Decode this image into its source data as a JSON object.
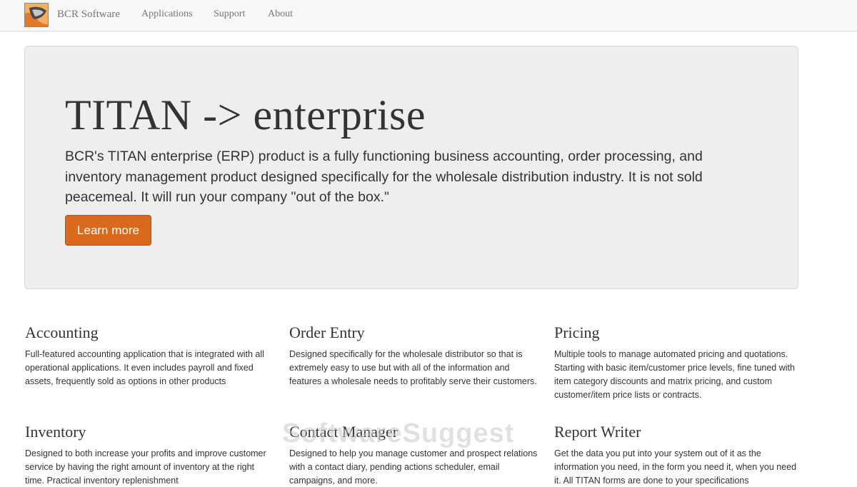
{
  "navbar": {
    "brand": "BCR Software",
    "links": [
      "Applications",
      "Support",
      "About"
    ]
  },
  "hero": {
    "title": "TITAN -> enterprise",
    "text": "BCR's TITAN enterprise (ERP) product is a fully functioning business accounting, order processing, and inventory management product designed specifically for the wholesale distribution industry. It is not sold peacemeal. It will run your company \"out of the box.\"",
    "button_label": "Learn more",
    "accent_color": "#d9691c"
  },
  "features": [
    {
      "title": "Accounting",
      "text": "Full-featured accounting application that is integrated with all operational applications. It even includes payroll and fixed assets, frequently sold as options in other products"
    },
    {
      "title": "Order Entry",
      "text": "Designed specifically for the wholesale distributor so that is extremely easy to use but with all of the information and features a wholesale needs to profitably serve their customers."
    },
    {
      "title": "Pricing",
      "text": "Multiple tools to manage automated pricing and quotations. Starting with basic item/customer price levels, fine tuned with item category discounts and matrix pricing, and custom customer/item price lists or contracts."
    },
    {
      "title": "Inventory",
      "text": "Designed to both increase your profits and improve customer service by having the right amount of inventory at the right time. Practical inventory replenishment"
    },
    {
      "title": "Contact Manager",
      "text": "Designed to help you manage customer and prospect relations with a contact diary, pending actions scheduler, email campaigns, and more."
    },
    {
      "title": "Report Writer",
      "text": "Get the data you put into your system out of it as the information you need, in the form you need it, when you need it. All TITAN forms are done to your specifications"
    }
  ],
  "watermark": "SoftwareSuggest"
}
